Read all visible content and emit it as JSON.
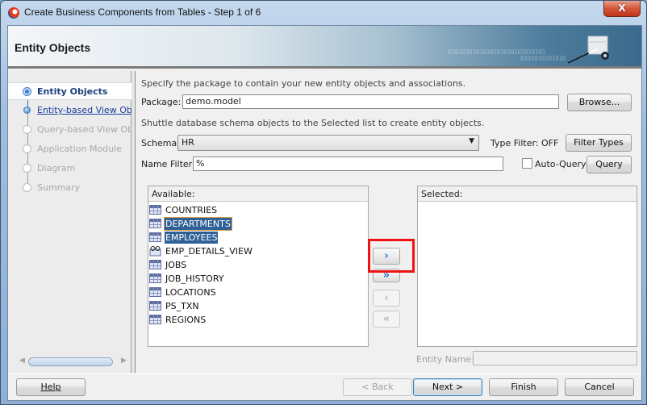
{
  "window": {
    "title": "Create Business Components from Tables - Step 1 of 6",
    "close_label": "X"
  },
  "header": {
    "title": "Entity Objects",
    "binary_line1": "0101010101010101010101010101",
    "binary_line2": "0101010101010"
  },
  "nav": {
    "steps": [
      {
        "label": "Entity Objects",
        "state": "current"
      },
      {
        "label": "Entity-based View Objects",
        "state": "link"
      },
      {
        "label": "Query-based View Objects",
        "state": "disabled"
      },
      {
        "label": "Application Module",
        "state": "disabled"
      },
      {
        "label": "Diagram",
        "state": "disabled"
      },
      {
        "label": "Summary",
        "state": "disabled"
      }
    ]
  },
  "form": {
    "package_instructions": "Specify the package to contain your new entity objects and associations.",
    "package_label": "Package:",
    "package_value": "demo.model",
    "browse_label": "Browse...",
    "shuttle_instructions": "Shuttle database schema objects to the Selected list to create entity objects.",
    "schema_label": "Schema:",
    "schema_value": "HR",
    "type_filter_status": "Type Filter: OFF",
    "filter_types_label": "Filter Types",
    "name_filter_label": "Name Filter:",
    "name_filter_value": "%",
    "auto_query_label": "Auto-Query",
    "auto_query_checked": false,
    "query_label": "Query"
  },
  "available": {
    "header": "Available:",
    "items": [
      {
        "name": "COUNTRIES",
        "type": "table",
        "selected": false
      },
      {
        "name": "DEPARTMENTS",
        "type": "table",
        "selected": true
      },
      {
        "name": "EMPLOYEES",
        "type": "table",
        "selected": true
      },
      {
        "name": "EMP_DETAILS_VIEW",
        "type": "view",
        "selected": false
      },
      {
        "name": "JOBS",
        "type": "table",
        "selected": false
      },
      {
        "name": "JOB_HISTORY",
        "type": "table",
        "selected": false
      },
      {
        "name": "LOCATIONS",
        "type": "table",
        "selected": false
      },
      {
        "name": "PS_TXN",
        "type": "table",
        "selected": false
      },
      {
        "name": "REGIONS",
        "type": "table",
        "selected": false
      }
    ]
  },
  "shuttle": {
    "move_selected": "›",
    "move_all": "»",
    "remove_selected": "‹",
    "remove_all": "«"
  },
  "selected": {
    "header": "Selected:",
    "items": [],
    "entity_name_label": "Entity Name:",
    "entity_name_value": ""
  },
  "footer": {
    "help_label": "Help",
    "back_label": "< Back",
    "next_label": "Next >",
    "finish_label": "Finish",
    "cancel_label": "Cancel"
  }
}
